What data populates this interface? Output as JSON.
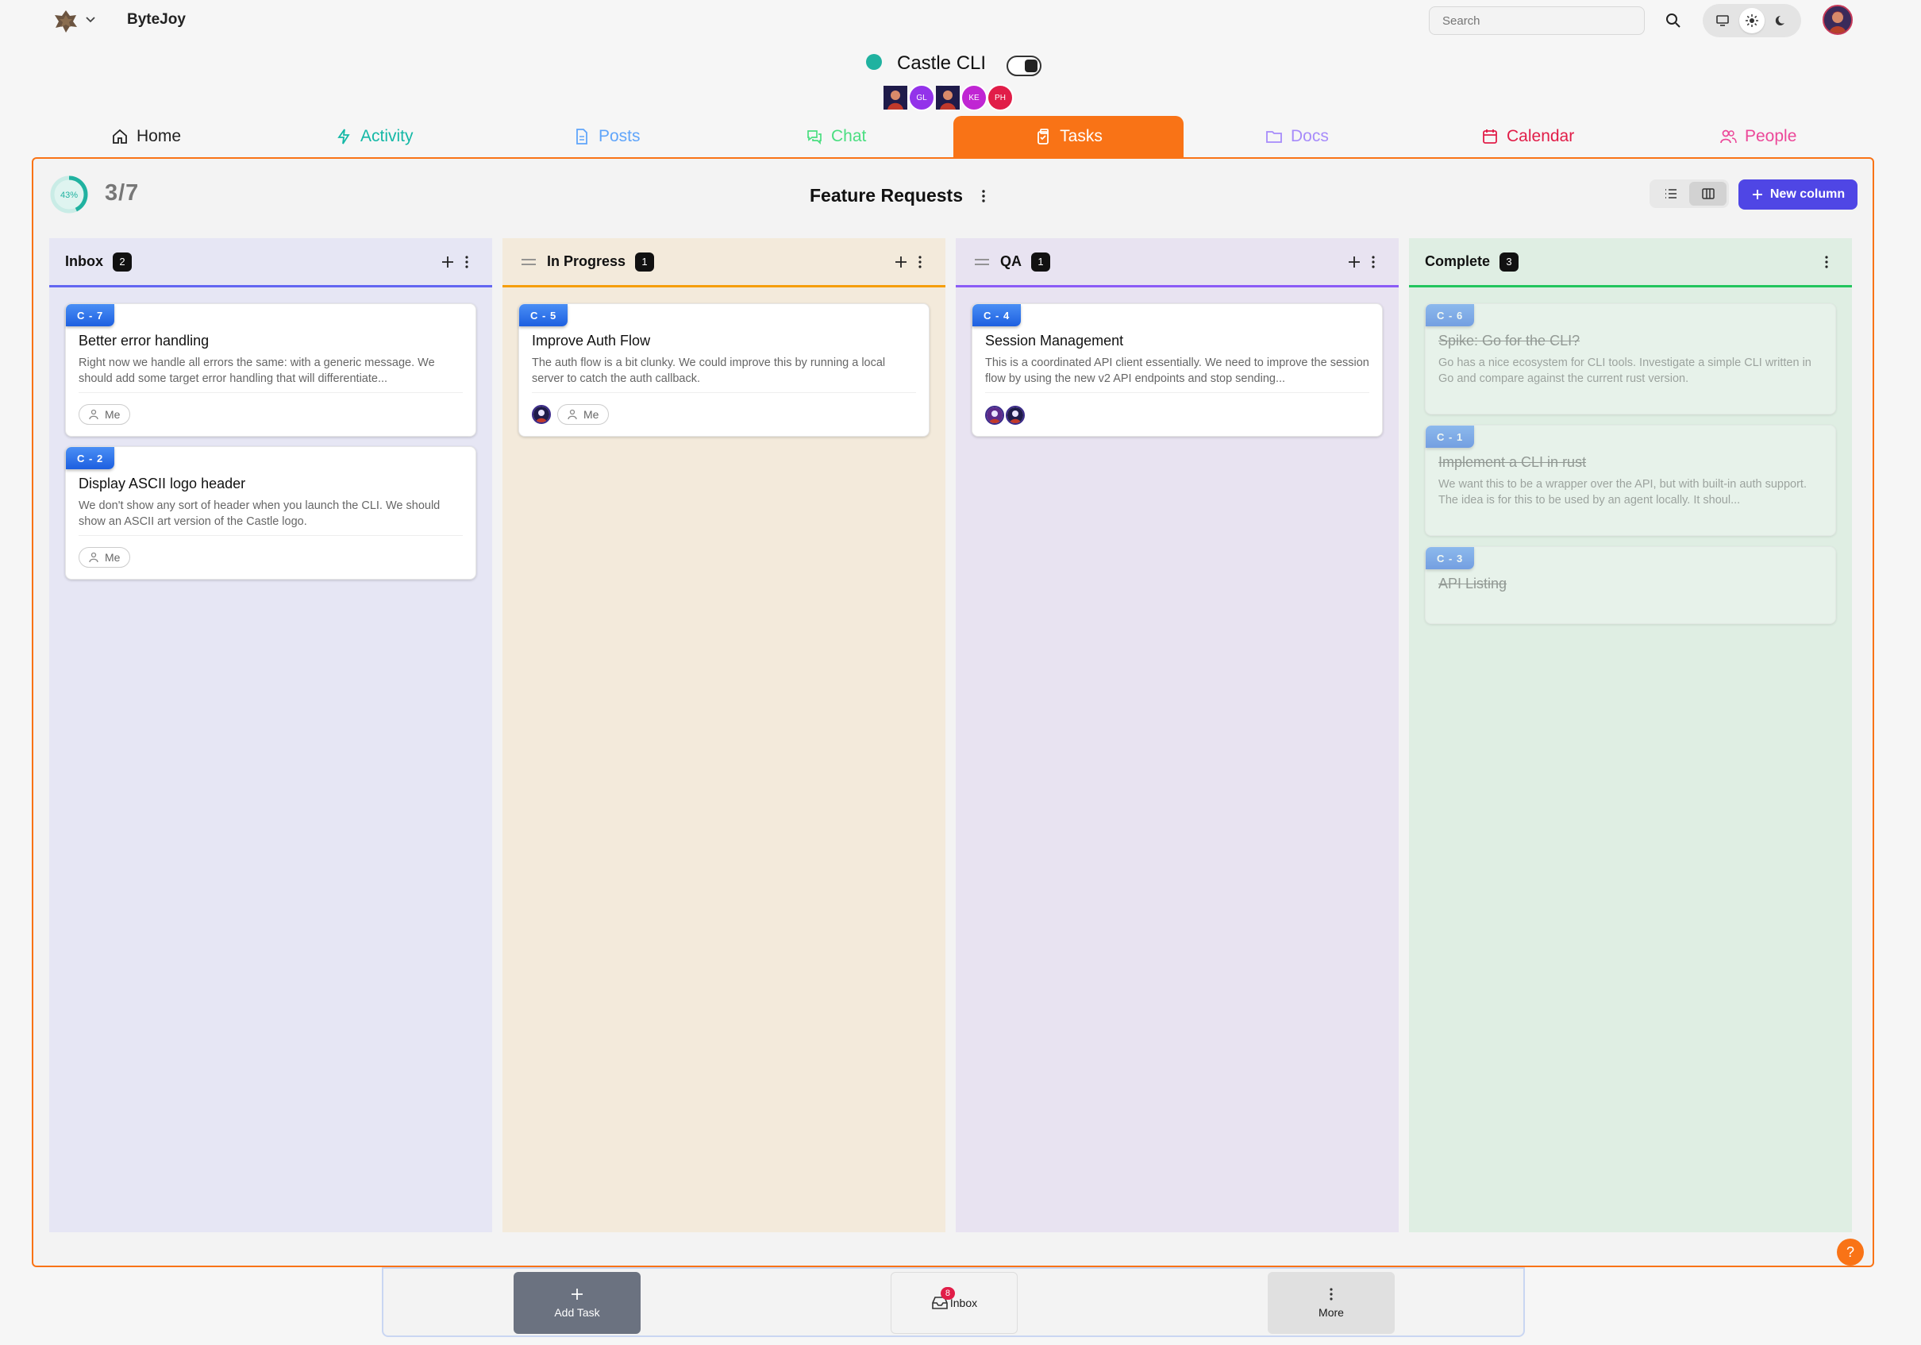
{
  "app": {
    "brand": "ByteJoy"
  },
  "search": {
    "placeholder": "Search"
  },
  "project": {
    "title": "Castle CLI",
    "status_color": "#20b2a0",
    "members": [
      {
        "initials": "",
        "color": "#3b2a8a"
      },
      {
        "initials": "GL",
        "color": "#9333ea"
      },
      {
        "initials": "",
        "color": "#3b2a8a"
      },
      {
        "initials": "KE",
        "color": "#c026d3"
      },
      {
        "initials": "PH",
        "color": "#e11d48"
      }
    ]
  },
  "tabs": [
    {
      "label": "Home",
      "color": "#222222"
    },
    {
      "label": "Activity",
      "color": "#14b8a6"
    },
    {
      "label": "Posts",
      "color": "#60a5fa"
    },
    {
      "label": "Chat",
      "color": "#4ade80"
    },
    {
      "label": "Tasks",
      "color": "#ffffff"
    },
    {
      "label": "Docs",
      "color": "#a78bfa"
    },
    {
      "label": "Calendar",
      "color": "#e11d48"
    },
    {
      "label": "People",
      "color": "#ec4899"
    }
  ],
  "board": {
    "progress_percent": 43,
    "progress_label": "43%",
    "ratio": "3/7",
    "title": "Feature Requests",
    "new_column_label": "New column"
  },
  "columns": [
    {
      "name": "Inbox",
      "count": "2",
      "bg": "#e6e6f4",
      "accent": "#6366f1",
      "cards": [
        {
          "id": "C-7",
          "title": "Better error handling",
          "desc": "Right now we handle all errors the same: with a generic message. We should add some target error handling that will differentiate...",
          "assignee": "Me"
        },
        {
          "id": "C-2",
          "title": "Display ASCII logo header",
          "desc": "We don't show any sort of header when you launch the CLI. We should show an ASCII art version of the Castle logo.",
          "assignee": "Me"
        }
      ]
    },
    {
      "name": "In Progress",
      "count": "1",
      "bg": "#f3eadb",
      "accent": "#f59e0b",
      "cards": [
        {
          "id": "C-5",
          "title": "Improve Auth Flow",
          "desc": "The auth flow is a bit clunky. We could improve this by running a local server to catch the auth callback.",
          "assignee": "Me"
        }
      ]
    },
    {
      "name": "QA",
      "count": "1",
      "bg": "#e8e3f1",
      "accent": "#8b5cf6",
      "cards": [
        {
          "id": "C-4",
          "title": "Session Management",
          "desc": "This is a coordinated API client essentially. We need to improve the session flow by using the new v2 API endpoints and stop sending..."
        }
      ]
    },
    {
      "name": "Complete",
      "count": "3",
      "bg": "#dfeee3",
      "accent": "#22c55e",
      "cards": [
        {
          "id": "C-6",
          "title": "Spike: Go for the CLI?",
          "desc": "Go has a nice ecosystem for CLI tools. Investigate a simple CLI written in Go and compare against the current rust version."
        },
        {
          "id": "C-1",
          "title": "Implement a CLI in rust",
          "desc": "We want this to be a wrapper over the API, but with built-in auth support. The idea is for this to be used by an agent locally. It shoul..."
        },
        {
          "id": "C-3",
          "title": "API Listing",
          "desc": ""
        }
      ]
    }
  ],
  "dock": {
    "add_task": "Add Task",
    "inbox": "Inbox",
    "inbox_badge": "8",
    "more": "More"
  },
  "help": {
    "label": "?"
  }
}
